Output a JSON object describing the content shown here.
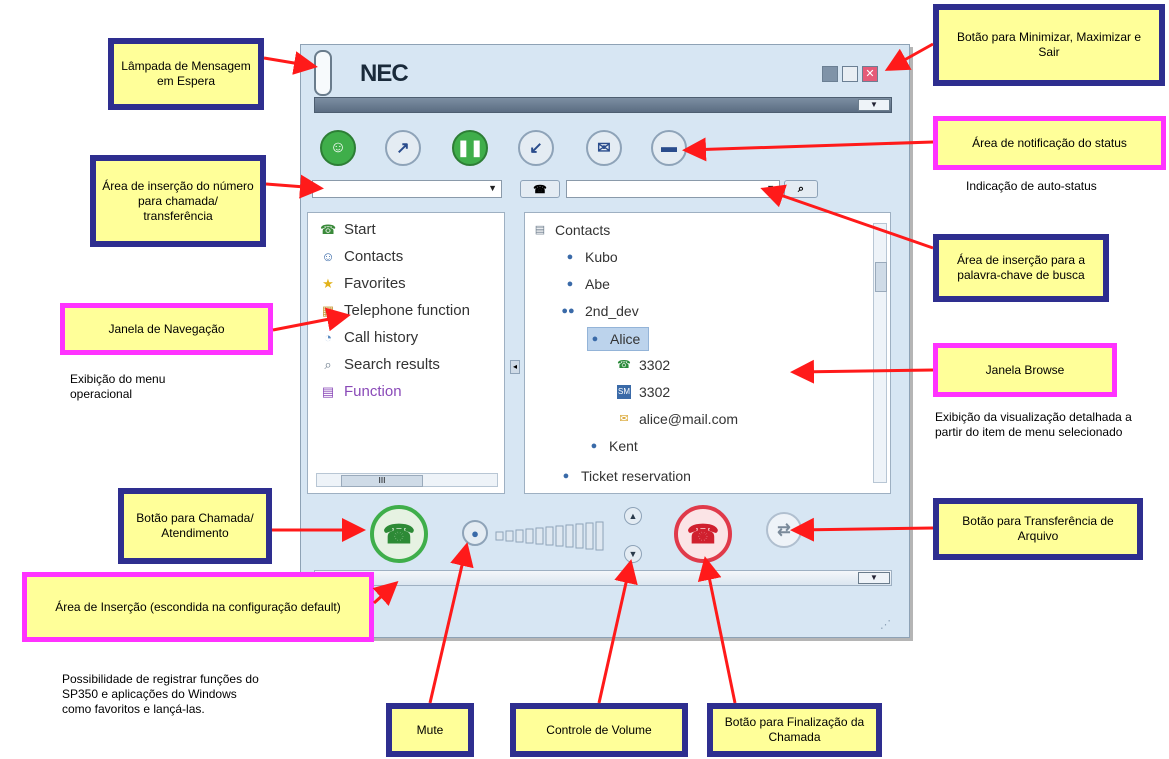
{
  "app": {
    "logo": "NEC",
    "nav_items": [
      "Start",
      "Contacts",
      "Favorites",
      "Telephone function",
      "Call history",
      "Search results",
      "Function"
    ],
    "browse": {
      "root": "Contacts",
      "items": [
        "Kubo",
        "Abe",
        "2nd_dev",
        "Alice",
        "3302",
        "3302",
        "alice@mail.com",
        "Kent",
        "Ticket reservation"
      ]
    },
    "hscroll_thumb": "III",
    "dropdown_caret": "▼"
  },
  "callouts": {
    "lamp": "Lâmpada de Mensagem em Espera",
    "minmax": "Botão para Minimizar, Maximizar e Sair",
    "status": "Área de notificação do status",
    "number_input": "Área de inserção do número para chamada/ transferência",
    "search_input": "Área de inserção para a palavra-chave de busca",
    "nav_window": "Janela de Navegação",
    "browse_window": "Janela Browse",
    "call_button": "Botão para Chamada/ Atendimento",
    "transfer_button": "Botão para Transferência de Arquivo",
    "insert_area": "Área de Inserção (escondida na configuração default)",
    "mute": "Mute",
    "volume": "Controle de Volume",
    "end_call": "Botão para Finalização da Chamada"
  },
  "notes": {
    "auto_status": "Indicação de auto-status",
    "nav_desc": "Exibição do menu operacional",
    "browse_desc": "Exibição da visualização detalhada a partir do item de menu selecionado",
    "insert_desc": "Possibilidade de registrar funções do SP350 e aplicações do Windows como favoritos e lançá-las."
  }
}
